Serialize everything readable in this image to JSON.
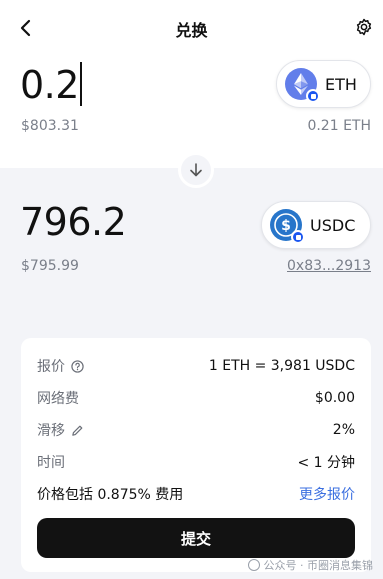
{
  "header": {
    "title": "兑换"
  },
  "pay": {
    "amount": "0.2",
    "fiat": "$803.31",
    "token": "ETH",
    "balance": "0.21 ETH"
  },
  "receive": {
    "amount": "796.2",
    "fiat": "$795.99",
    "token": "USDC",
    "address": "0x83...2913"
  },
  "details": {
    "quote_label": "报价",
    "quote_value": "1 ETH = 3,981 USDC",
    "network_fee_label": "网络费",
    "network_fee_value": "$0.00",
    "slippage_label": "滑移",
    "slippage_value": "2%",
    "time_label": "时间",
    "time_value": "< 1 分钟",
    "fee_text": "价格包括 0.875% 费用",
    "more_quotes": "更多报价",
    "submit": "提交"
  },
  "watermark": {
    "text": "公众号 · 币圈消息集锦"
  },
  "colors": {
    "accent": "#3b6fe0",
    "badge": "#1a56f0",
    "eth": "#627eea",
    "usdc": "#2775ca"
  },
  "icons": [
    "back-arrow-icon",
    "gear-icon",
    "eth-icon",
    "usdc-icon",
    "down-arrow-icon",
    "info-icon",
    "pencil-icon"
  ]
}
